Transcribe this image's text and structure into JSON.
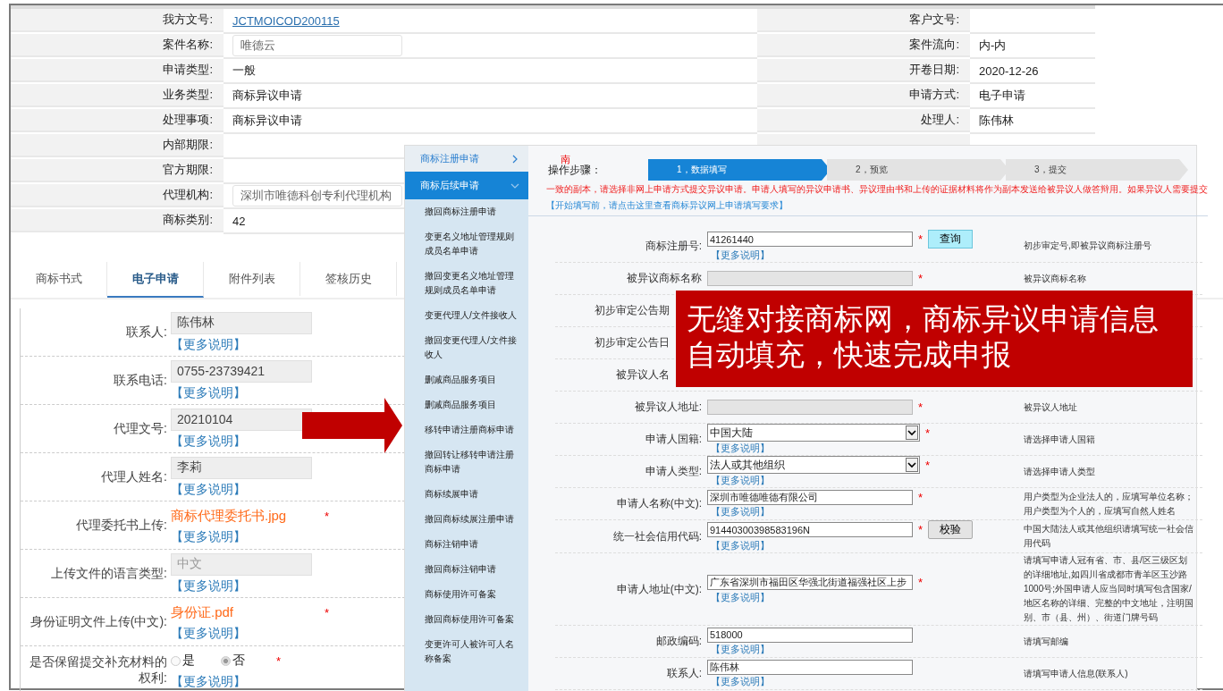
{
  "top_form": {
    "left": [
      {
        "label": "我方文号:",
        "kind": "link",
        "value": "JCTMOICOD200115"
      },
      {
        "label": "案件名称:",
        "kind": "input",
        "value": "唯德云"
      },
      {
        "label": "申请类型:",
        "kind": "text",
        "value": "一般"
      },
      {
        "label": "业务类型:",
        "kind": "text",
        "value": "商标异议申请"
      },
      {
        "label": "处理事项:",
        "kind": "text",
        "value": "商标异议申请"
      },
      {
        "label": "内部期限:"
      },
      {
        "label": "官方期限:"
      },
      {
        "label": "代理机构:",
        "kind": "input",
        "value": "深圳市唯德科创专利代理机构"
      },
      {
        "label": "商标类别:",
        "kind": "text",
        "value": "42"
      }
    ],
    "right": [
      {
        "label": "客户文号:"
      },
      {
        "label": "案件流向:",
        "value": "内-内"
      },
      {
        "label": "开卷日期:",
        "value": "2020-12-26"
      },
      {
        "label": "申请方式:",
        "value": "电子申请"
      },
      {
        "label": "处理人:",
        "value": "陈伟林"
      }
    ]
  },
  "tabs": [
    {
      "label": "商标书式",
      "selected": false
    },
    {
      "label": "电子申请",
      "selected": true
    },
    {
      "label": "附件列表",
      "selected": false
    },
    {
      "label": "签核历史",
      "selected": false
    }
  ],
  "form": [
    {
      "label": "联系人:",
      "kind": "input",
      "value": "陈伟林",
      "disabled": false,
      "more": "【更多说明】"
    },
    {
      "label": "联系电话:",
      "kind": "input",
      "value": "0755-23739421",
      "disabled": false,
      "more": "【更多说明】"
    },
    {
      "label": "代理文号:",
      "kind": "input",
      "value": "20210104",
      "disabled": false,
      "more": "【更多说明】"
    },
    {
      "label": "代理人姓名:",
      "kind": "input",
      "value": "李莉",
      "disabled": false,
      "more": "【更多说明】"
    },
    {
      "label": "代理委托书上传:",
      "kind": "file",
      "value": "商标代理委托书.jpg",
      "required_mark": "*",
      "more": "【更多说明】"
    },
    {
      "label": "上传文件的语言类型:",
      "kind": "input",
      "value": "中文",
      "disabled": true,
      "more": "【更多说明】"
    },
    {
      "label": "身份证明文件上传(中文):",
      "kind": "file",
      "value": "身份证.pdf",
      "required_mark": "*",
      "more": "【更多说明】"
    },
    {
      "label": "是否保留提交补充材料的权利:",
      "kind": "radio",
      "required_mark": "*",
      "options": [
        {
          "label": "是",
          "selected": false
        },
        {
          "label": "否",
          "selected": true
        }
      ],
      "more": "【更多说明】"
    }
  ],
  "overlay": {
    "sidebar": [
      {
        "label": "商标注册申请",
        "expanded": false,
        "selected": false
      },
      {
        "label": "商标后续申请",
        "expanded": true,
        "selected": true,
        "children": [
          "撤回商标注册申请",
          "变更名义地址管理规则成员名单申请",
          "撤回变更名义地址管理规则成员名单申请",
          "变更代理人/文件接收人",
          "撤回变更代理人/文件接收人",
          "删减商品服务项目",
          "删减商品服务项目",
          "移转申请注册商标申请",
          "撤回转让移转申请注册商标申请",
          "商标续展申请",
          "撤回商标续展注册申请",
          "商标注销申请",
          "撤回商标注销申请",
          "商标使用许可备案",
          "撤回商标使用许可备案",
          "变更许可人被许可人名称备案"
        ]
      }
    ],
    "mark": "南",
    "steps_label": "操作步骤：",
    "steps": [
      {
        "label": "1，数据填写",
        "selected": true
      },
      {
        "label": "2，预览",
        "selected": false
      },
      {
        "label": "3，提交",
        "selected": false
      }
    ],
    "notice": "一致的副本，请选择非网上申请方式提交异议申请。申请人填写的异议申请书、异议理由书和上传的证据材料将作为副本发送给被异议人做答辩用。如果异议人需要提交",
    "guide_link": "【开始填写前，请点击这里查看商标异议网上申请填写要求】",
    "fields": [
      {
        "label": "商标注册号:",
        "kind": "text",
        "value": "41261440",
        "required_mark": "*",
        "button": {
          "label": "查询",
          "primary": true
        },
        "more": "【更多说明】",
        "hint": "初步审定号,即被异议商标注册号"
      },
      {
        "label": "被异议商标名称",
        "kind": "readonly",
        "required_mark": "*",
        "hint": "被异议商标名称"
      },
      {
        "label": "初步审定公告期",
        "kind": "none"
      },
      {
        "label": "初步审定公告日",
        "kind": "none"
      },
      {
        "label": "被异议人名",
        "kind": "none"
      },
      {
        "label": "被异议人地址:",
        "kind": "readonly",
        "required_mark": "*",
        "hint": "被异议人地址"
      },
      {
        "label": "申请人国籍:",
        "kind": "select",
        "value": "中国大陆",
        "required_mark": "*",
        "more": "【更多说明】",
        "hint": "请选择申请人国籍"
      },
      {
        "label": "申请人类型:",
        "kind": "select",
        "value": "法人或其他组织",
        "required_mark": "*",
        "more": "【更多说明】",
        "hint": "请选择申请人类型"
      },
      {
        "label": "申请人名称(中文):",
        "kind": "text",
        "value": "深圳市唯德唯德有限公司",
        "required_mark": "*",
        "more": "【更多说明】",
        "hint": "用户类型为企业法人的，应填写单位名称；用户类型为个人的，应填写自然人姓名"
      },
      {
        "label": "统一社会信用代码:",
        "kind": "text",
        "value": "91440300398583196N",
        "required_mark": "*",
        "button": {
          "label": "校验",
          "primary": false
        },
        "more": "【更多说明】",
        "hint": "中国大陆法人或其他组织请填写统一社会信用代码"
      },
      {
        "label": "申请人地址(中文):",
        "kind": "text",
        "value": "广东省深圳市福田区华强北街道福强社区上步",
        "required_mark": "*",
        "more": "【更多说明】",
        "hint": "请填写申请人冠有省、市、县/区三级区划的详细地址,如四川省成都市青羊区玉沙路1000号;外国申请人应当同时填写包含国家/地区名称的详细、完整的中文地址，注明国别、市（县、州）、街道门牌号码"
      },
      {
        "label": "邮政编码:",
        "kind": "text",
        "value": "518000",
        "more": "【更多说明】",
        "hint": "请填写邮编"
      },
      {
        "label": "联系人:",
        "kind": "text",
        "value": "陈伟林",
        "more": "【更多说明】",
        "hint": "请填写申请人信息(联系人)"
      }
    ]
  },
  "callout": "无缝对接商标网，商标异议申请信息自动填充，快速完成申报"
}
